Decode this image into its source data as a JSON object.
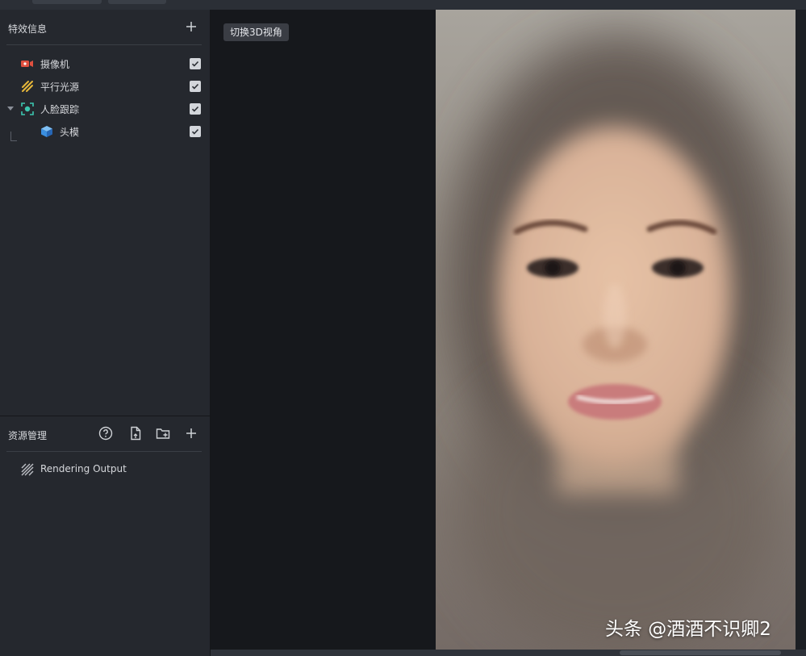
{
  "effects_panel": {
    "title": "特效信息",
    "items": [
      {
        "label": "摄像机",
        "icon": "camera-icon",
        "checked": true
      },
      {
        "label": "平行光源",
        "icon": "directional-light-icon",
        "checked": true
      },
      {
        "label": "人脸跟踪",
        "icon": "face-tracking-icon",
        "checked": true
      },
      {
        "label": "头模",
        "icon": "head-model-cube-icon",
        "checked": true
      }
    ]
  },
  "resources_panel": {
    "title": "资源管理",
    "items": [
      {
        "label": "Rendering Output",
        "icon": "rendering-output-icon"
      }
    ]
  },
  "viewport": {
    "toggle_label": "切换3D视角"
  },
  "watermark": "头条 @酒酒不识卿2",
  "colors": {
    "panel_bg": "#25282e",
    "viewport_bg": "#16181c",
    "camera_icon": "#e0503f",
    "light_icon": "#e8b83a",
    "face_icon": "#3cc7b0",
    "cube_icon": "#3b8fe0"
  }
}
